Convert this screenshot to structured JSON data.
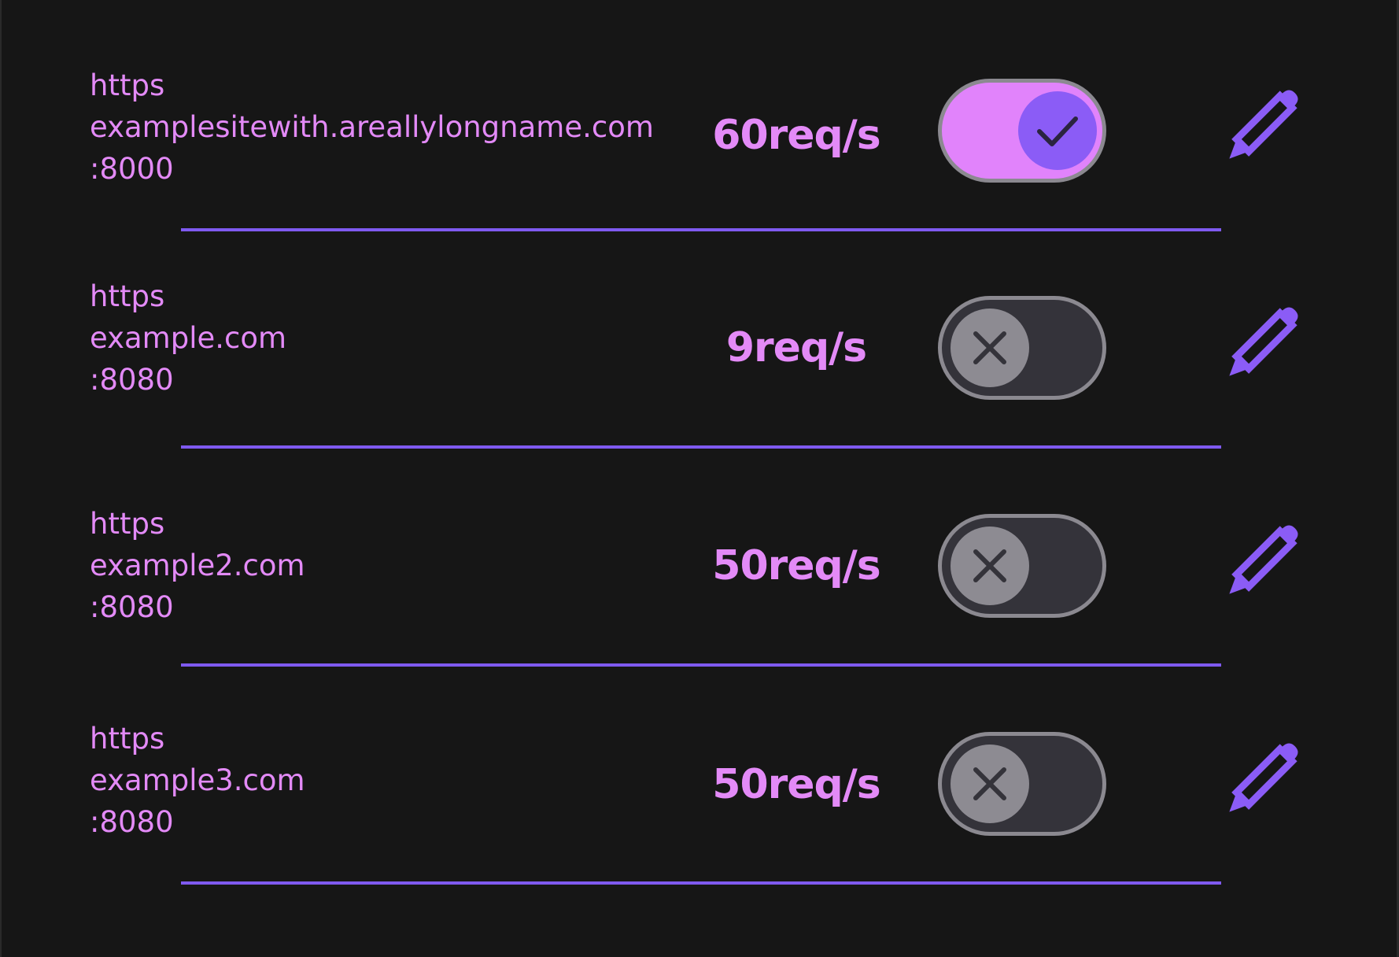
{
  "entries": [
    {
      "protocol": "https",
      "host": "examplesitewith.areallylongname.com",
      "port": ":8000",
      "rate": "60req/s",
      "enabled": true
    },
    {
      "protocol": "https",
      "host": "example.com",
      "port": ":8080",
      "rate": "9req/s",
      "enabled": false
    },
    {
      "protocol": "https",
      "host": "example2.com",
      "port": ":8080",
      "rate": "50req/s",
      "enabled": false
    },
    {
      "protocol": "https",
      "host": "example3.com",
      "port": ":8080",
      "rate": "50req/s",
      "enabled": false
    }
  ],
  "icons": {
    "toggle_on": "check-icon",
    "toggle_off": "x-icon",
    "edit": "pencil-icon"
  },
  "colors": {
    "background": "#161616",
    "text_accent": "#e38af7",
    "toggle_on_track": "#e183fb",
    "toggle_on_knob": "#8b5cf6",
    "toggle_off_track": "#34333a",
    "toggle_off_knob": "#8d8b92",
    "toggle_border": "#8b8990",
    "divider": "#7f5af0",
    "edit_icon": "#8b5cf6"
  }
}
